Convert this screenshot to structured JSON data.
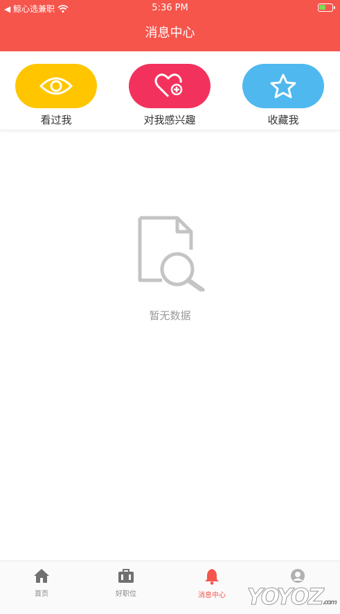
{
  "status": {
    "carrier": "◀ 鲸心选兼职",
    "time": "5:36 PM",
    "battery_level": 0.45
  },
  "nav": {
    "title": "消息中心"
  },
  "quick_actions": [
    {
      "label": "看过我",
      "color": "#ffc600",
      "icon": "eye-icon"
    },
    {
      "label": "对我感兴趣",
      "color": "#f2325d",
      "icon": "heart-plus-icon"
    },
    {
      "label": "收藏我",
      "color": "#4fb8ef",
      "icon": "star-icon"
    }
  ],
  "empty_state": {
    "text": "暂无数据",
    "icon": "document-search-icon"
  },
  "tabs": [
    {
      "label": "首页",
      "icon": "home-icon"
    },
    {
      "label": "好职位",
      "icon": "briefcase-icon"
    },
    {
      "label": "消息中心",
      "icon": "bell-icon",
      "active": true
    },
    {
      "label": "",
      "icon": "profile-icon"
    }
  ],
  "colors": {
    "accent": "#f6554c",
    "muted": "#9a9a9a"
  },
  "watermark": {
    "text": "YOYOZ",
    "suffix": ".com"
  }
}
